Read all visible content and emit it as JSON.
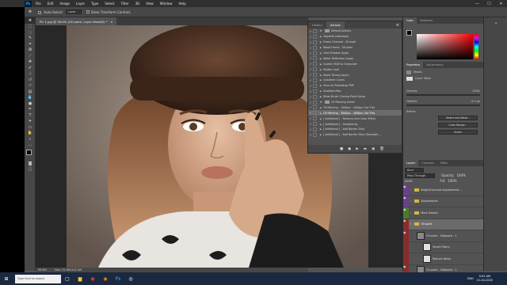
{
  "menubar": {
    "logo": "Ps",
    "items": [
      "File",
      "Edit",
      "Image",
      "Layer",
      "Type",
      "Select",
      "Filter",
      "3D",
      "View",
      "Window",
      "Help"
    ],
    "window_buttons": [
      "—",
      "☐",
      "✕"
    ]
  },
  "optionsbar": {
    "auto_select_label": "Auto-Select:",
    "auto_select_value": "Layer",
    "show_transform_label": "Show Transform Controls"
  },
  "document": {
    "tab_title": "Pic 1.jpg @ 36.6% (Oil paint, Layer Mask/8) *",
    "close_glyph": "×",
    "zoom": "36.6%",
    "doc_size": "Doc: 22.9M/102.9M"
  },
  "actions_panel": {
    "tabs": [
      "History",
      "Actions"
    ],
    "menu_glyph": "≡",
    "items": [
      {
        "label": "Default Actions",
        "type": "folder",
        "checked": true
      },
      {
        "label": "Vignette (selection)",
        "type": "action",
        "checked": true
      },
      {
        "label": "Frame Channel - 50 pixel",
        "type": "action",
        "checked": true
      },
      {
        "label": "Wood Frame - 50 pixel",
        "type": "action",
        "checked": true
      },
      {
        "label": "Cast Shadow (type)",
        "type": "action",
        "checked": true
      },
      {
        "label": "Water Reflection (type)",
        "type": "action",
        "checked": true
      },
      {
        "label": "Custom RGB to Grayscale",
        "type": "action",
        "checked": true
      },
      {
        "label": "Molten Lead",
        "type": "action",
        "checked": true
      },
      {
        "label": "Sepia Toning (layer)",
        "type": "action",
        "checked": true
      },
      {
        "label": "Quadrant Colors",
        "type": "action",
        "checked": true
      },
      {
        "label": "Save As Photoshop PDF",
        "type": "action",
        "checked": true
      },
      {
        "label": "Gradient Map",
        "type": "action",
        "checked": true
      },
      {
        "label": "Mixer Brush Cloning Paint Setup",
        "type": "action",
        "checked": true
      },
      {
        "label": "Oil Painting Action",
        "type": "folder",
        "checked": true
      },
      {
        "label": "Oil Painting - 1000px - 2000px Use This",
        "type": "action",
        "checked": true
      },
      {
        "label": "Oil Painting - 3000px - 4000px Use This",
        "type": "action",
        "checked": true,
        "selected": true
      },
      {
        "label": "[ Additional ] - Textures And Color Effect",
        "type": "action",
        "checked": true
      },
      {
        "label": "[ Additional ] - Sharpening",
        "type": "action",
        "checked": true
      },
      {
        "label": "[ Additional ] - Add Border 25px",
        "type": "action",
        "checked": true
      },
      {
        "label": "[ Additional ] - Add Border 25px (Rounded ...",
        "type": "action",
        "checked": true
      }
    ],
    "footer_icons": [
      "■",
      "●",
      "▶",
      "▬",
      "▣",
      "🗑"
    ]
  },
  "color_panel": {
    "tabs": [
      "Color",
      "Swatches"
    ],
    "foreground": "#000000",
    "background": "#ffffff"
  },
  "properties_panel": {
    "tabs": [
      "Properties",
      "Adjustments"
    ],
    "section": "Masks",
    "mask_label": "Layer Mask",
    "density_label": "Density:",
    "density_value": "100%",
    "feather_label": "Feather:",
    "feather_value": "0.0 px",
    "refine_label": "Refine:",
    "buttons": [
      "Select and Mask...",
      "Color Range...",
      "Invert"
    ]
  },
  "layers_panel": {
    "tabs": [
      "Layers",
      "Channels",
      "Paths"
    ],
    "kind_label": "Kind",
    "blend_mode": "Pass Through",
    "opacity_label": "Opacity:",
    "opacity_value": "100%",
    "lock_label": "Lock:",
    "fill_label": "Fill:",
    "fill_value": "100%",
    "rows": [
      {
        "label": "Bright/Contrast Adjustments ...",
        "type": "group",
        "tag": "#6a3f8f"
      },
      {
        "label": "Adjustments",
        "type": "group",
        "tag": "#6a3f8f"
      },
      {
        "label": "More Details",
        "type": "group",
        "tag": "#4d7a2e"
      },
      {
        "label": "Oil paint",
        "type": "group",
        "tag": "#8e2a2a",
        "selected": true
      },
      {
        "label": "Oil paint - Softpaint - 1",
        "type": "layer",
        "tag": "#8e2a2a"
      },
      {
        "label": "Smart Filters",
        "type": "sub",
        "tag": "#8e2a2a"
      },
      {
        "label": "Reduce Noise",
        "type": "sub",
        "tag": "#8e2a2a"
      },
      {
        "label": "Oil paint - Softpaint - 1",
        "type": "layer",
        "tag": "#8e2a2a"
      }
    ]
  },
  "taskbar": {
    "start_glyph": "⊞",
    "search_placeholder": "Type here to search",
    "time": "0:03 AM",
    "date": "21-04-2020",
    "lang": "ENG"
  }
}
